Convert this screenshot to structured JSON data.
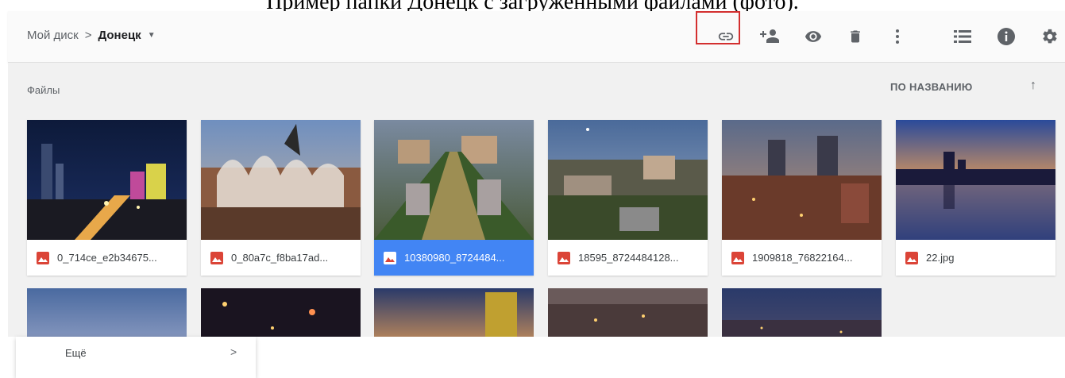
{
  "caption": "Пример папки Донецк с загруженными файлами (фото).",
  "breadcrumb": {
    "root": "Мой диск",
    "separator": ">",
    "current": "Донецк"
  },
  "toolbar_icons": [
    "link-icon",
    "add-person-icon",
    "eye-icon",
    "trash-icon",
    "more-vert-icon",
    "list-view-icon",
    "info-icon",
    "settings-icon"
  ],
  "section": {
    "files_label": "Файлы",
    "sort_label": "ПО НАЗВАНИЮ",
    "sort_arrow": "↑"
  },
  "files": [
    {
      "name": "0_714ce_e2b34675...",
      "selected": false
    },
    {
      "name": "0_80a7c_f8ba17ad...",
      "selected": false
    },
    {
      "name": "10380980_8724484...",
      "selected": true
    },
    {
      "name": "18595_8724484128...",
      "selected": false
    },
    {
      "name": "1909818_76822164...",
      "selected": false
    },
    {
      "name": "22.jpg",
      "selected": false
    }
  ],
  "menu": {
    "item_label": "Ещё",
    "item_arrow": ">"
  },
  "colors": {
    "accent": "#4285f4",
    "file_icon": "#db4437",
    "highlight": "#d32f2f"
  }
}
